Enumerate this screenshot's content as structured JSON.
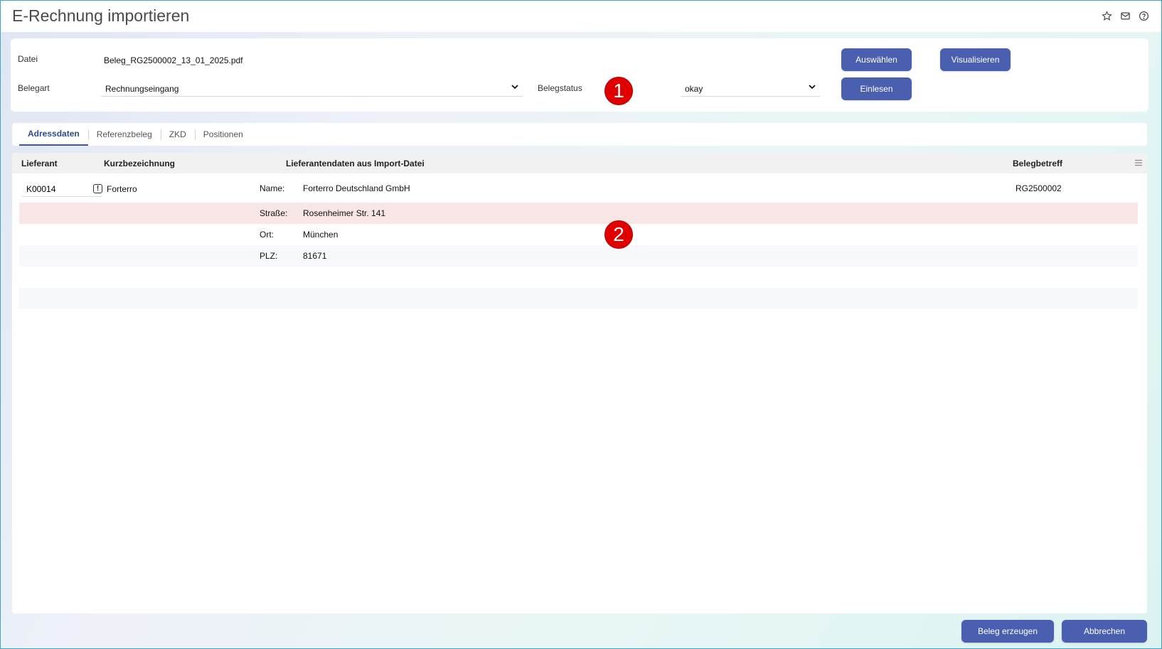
{
  "window": {
    "title": "E-Rechnung importieren",
    "icons": [
      "star-icon",
      "mail-icon",
      "help-icon"
    ]
  },
  "header": {
    "datei_label": "Datei",
    "datei_value": "Beleg_RG2500002_13_01_2025.pdf",
    "belegart_label": "Belegart",
    "belegart_value": "Rechnungseingang",
    "belegstatus_label": "Belegstatus",
    "belegstatus_value": "okay",
    "buttons": {
      "auswaehlen": "Auswählen",
      "visualisieren": "Visualisieren",
      "einlesen": "Einlesen"
    }
  },
  "markers": {
    "one": "1",
    "two": "2"
  },
  "tabs": [
    {
      "label": "Adressdaten",
      "active": true
    },
    {
      "label": "Referenzbeleg",
      "active": false
    },
    {
      "label": "ZKD",
      "active": false
    },
    {
      "label": "Positionen",
      "active": false
    }
  ],
  "grid": {
    "columns": {
      "lieferant": "Lieferant",
      "kurzbezeichnung": "Kurzbezeichnung",
      "lieferantendaten": "Lieferantendaten aus Import-Datei",
      "belegbetreff": "Belegbetreff"
    },
    "supplier": {
      "code": "K00014",
      "short_name": "Forterro",
      "belegbetreff": "RG2500002"
    },
    "fields": [
      {
        "label": "Name:",
        "value": "Forterro Deutschland GmbH",
        "state": "normal"
      },
      {
        "label": "Straße:",
        "value": "Rosenheimer Str. 141",
        "state": "error"
      },
      {
        "label": "Ort:",
        "value": "München",
        "state": "normal"
      },
      {
        "label": "PLZ:",
        "value": "81671",
        "state": "alt"
      }
    ]
  },
  "footer": {
    "create_label": "Beleg erzeugen",
    "cancel_label": "Abbrechen"
  },
  "colors": {
    "accent": "#4a5fb0",
    "error_row": "#f8e5e5",
    "marker": "#e00000"
  }
}
